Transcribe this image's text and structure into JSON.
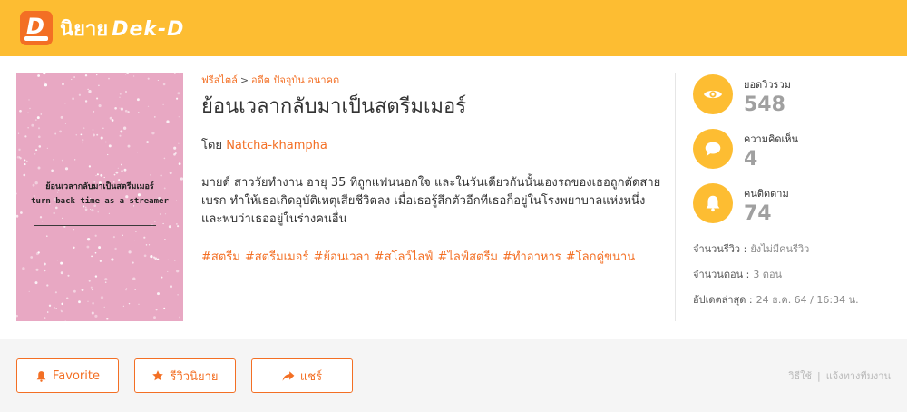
{
  "header": {
    "logo_text": "นิยาย",
    "brand_text": "Dek-D",
    "badge_letter": "D"
  },
  "cover": {
    "title_th": "ย้อนเวลากลับมาเป็นสตรีมเมอร์",
    "title_en": "turn back time as a streamer",
    "background": "#e8a8c3"
  },
  "story": {
    "breadcrumb_category": "ฟรีสไตล์",
    "breadcrumb_sep": ">",
    "breadcrumb_sub": "อดีต ปัจจุบัน อนาคต",
    "title": "ย้อนเวลากลับมาเป็นสตรีมเมอร์",
    "author_prefix": "โดย",
    "author": "Natcha-khampha",
    "description": "มายด์ สาววัยทำงาน อายุ 35 ที่ถูกแฟนนอกใจ และในวันเดียวกันนั้นเองรถของเธอถูกตัดสายเบรก ทำให้เธอเกิดอุบัติเหตุเสียชีวิตลง เมื่อเธอรู้สึกตัวอีกทีเธอก็อยู่ในโรงพยาบาลแห่งหนึ่ง และพบว่าเธออยู่ในร่างคนอื่น",
    "tags": [
      "#สตรีม",
      "#สตรีมเมอร์",
      "#ย้อนเวลา",
      "#สโลว์ไลฟ์",
      "#ไลฟ์สตรีม",
      "#ทำอาหาร",
      "#โลกคู่ขนาน"
    ]
  },
  "stats": {
    "views_label": "ยอดวิวรวม",
    "views_value": "548",
    "comments_label": "ความคิดเห็น",
    "comments_value": "4",
    "followers_label": "คนติดตาม",
    "followers_value": "74"
  },
  "meta": {
    "reviews_label": "จำนวนรีวิว :",
    "reviews_value": "ยังไม่มีคนรีวิว",
    "episodes_label": "จำนวนตอน :",
    "episodes_value": "3 ตอน",
    "updated_label": "อัปเดตล่าสุด :",
    "updated_value": "24 ธ.ค. 64 / 16:34 น."
  },
  "actions": {
    "favorite_label": "Favorite",
    "review_label": "รีวิวนิยาย",
    "share_label": "แชร์"
  },
  "footer_links": {
    "howto": "วิธีใช้",
    "separator": "|",
    "report": "แจ้งทางทีมงาน"
  },
  "colors": {
    "accent": "#f36f24",
    "header": "#fdbd32",
    "stat_value": "#a0a0a0"
  }
}
